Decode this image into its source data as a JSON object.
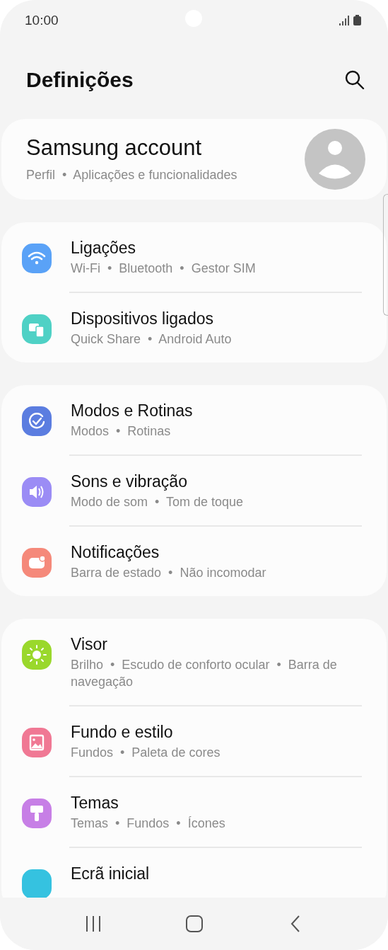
{
  "status_bar": {
    "time": "10:00"
  },
  "header": {
    "title": "Definições"
  },
  "account": {
    "title": "Samsung account",
    "subtitle": "Perfil  •  Aplicações e funcionalidades"
  },
  "groups": [
    {
      "items": [
        {
          "title": "Ligações",
          "subtitle": "Wi-Fi  •  Bluetooth  •  Gestor SIM",
          "kind": "wifi",
          "color": "#5aa2f7"
        },
        {
          "title": "Dispositivos ligados",
          "subtitle": "Quick Share  •  Android Auto",
          "kind": "devices",
          "color": "#4fd1c5"
        }
      ]
    },
    {
      "items": [
        {
          "title": "Modos e Rotinas",
          "subtitle": "Modos  •  Rotinas",
          "kind": "check",
          "color": "#5b7de0"
        },
        {
          "title": "Sons e vibração",
          "subtitle": "Modo de som  •  Tom de toque",
          "kind": "sound",
          "color": "#9b8cf5"
        },
        {
          "title": "Notificações",
          "subtitle": "Barra de estado  •  Não incomodar",
          "kind": "bell",
          "color": "#f5897a"
        }
      ]
    },
    {
      "items": [
        {
          "title": "Visor",
          "subtitle": "Brilho  •  Escudo de conforto ocular  •  Barra de navegação",
          "kind": "sun",
          "color": "#9ad82c"
        },
        {
          "title": "Fundo e estilo",
          "subtitle": "Fundos  •  Paleta de cores",
          "kind": "image",
          "color": "#f07894"
        },
        {
          "title": "Temas",
          "subtitle": "Temas  •  Fundos  •  Ícones",
          "kind": "brush",
          "color": "#c77fe6"
        },
        {
          "title": "Ecrã inicial",
          "kind": "home",
          "color": "#35c2e0"
        }
      ]
    }
  ]
}
